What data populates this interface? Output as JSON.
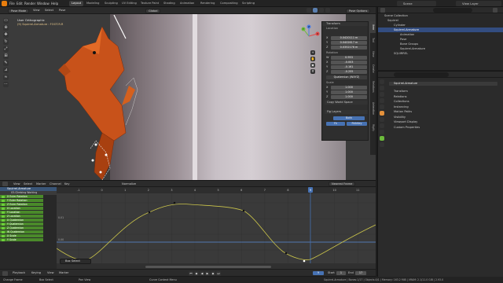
{
  "topbar": {
    "menus": [
      "File",
      "Edit",
      "Render",
      "Window",
      "Help"
    ],
    "workspaces": [
      "Layout",
      "Modeling",
      "Sculpting",
      "UV Editing",
      "Texture Paint",
      "Shading",
      "Animation",
      "Rendering",
      "Compositing",
      "Scripting"
    ],
    "active_workspace": "Layout",
    "scene": "Scene",
    "view_layer": "View Layer"
  },
  "viewport": {
    "mode": "Pose Mode",
    "menus": [
      "View",
      "Select",
      "Pose"
    ],
    "overlay_title": "User Orthographic",
    "overlay_subtitle": "(9) Squirrel-Armature : FOOT.R.R",
    "transform_orientation": "Global",
    "pose_options": "Pose Options",
    "axis_x": "X",
    "axis_y": "Y",
    "axis_z": "Z",
    "colors": {
      "background": "#3b3b3b",
      "wall_light": "#c8c0c6",
      "squirrel": "#c8521a"
    }
  },
  "npanel": {
    "title": "Transform",
    "location_label": "Location",
    "location": [
      {
        "axis": "X",
        "value": "0.0420111 m"
      },
      {
        "axis": "Y",
        "value": "0.0402617 m"
      },
      {
        "axis": "Z",
        "value": "0.0352176 m"
      }
    ],
    "rotation_label": "Rotation",
    "rotation": [
      {
        "axis": "W",
        "value": "0.953"
      },
      {
        "axis": "X",
        "value": "-0.003"
      },
      {
        "axis": "Y",
        "value": "-0.161"
      },
      {
        "axis": "Z",
        "value": "-0.255"
      }
    ],
    "rotation_mode": "Quaternion (WXYZ)",
    "scale_label": "Scale",
    "scale": [
      {
        "axis": "X",
        "value": "1.000"
      },
      {
        "axis": "Y",
        "value": "1.000"
      },
      {
        "axis": "Z",
        "value": "1.000"
      }
    ],
    "copy_world_space": "Copy World Space",
    "ik_fk_title": "Fig Layers",
    "buttons": [
      "Both",
      "Fk",
      "FkIkKey"
    ],
    "tabs": [
      "Item",
      "Tool",
      "View",
      "Create",
      "Relations",
      "Animation",
      "Rigify"
    ]
  },
  "outliner": {
    "title": "Scene Collection",
    "items": [
      {
        "label": "Squirrel",
        "indent": 1
      },
      {
        "label": "Cylinder",
        "indent": 2
      },
      {
        "label": "Squirrel-Armature",
        "indent": 2,
        "selected": true
      },
      {
        "label": "Animation",
        "indent": 3
      },
      {
        "label": "Pose",
        "indent": 3
      },
      {
        "label": "Bone Groups",
        "indent": 3
      },
      {
        "label": "Squirrel-Armature",
        "indent": 3
      },
      {
        "label": "SQUIRREL",
        "indent": 2
      }
    ]
  },
  "properties": {
    "object_name": "Squirrel-Armature",
    "sections": [
      "Transform",
      "Relations",
      "Collections",
      "Instancing",
      "Motion Paths",
      "Visibility",
      "Viewport Display",
      "Custom Properties"
    ]
  },
  "graph": {
    "menus": [
      "View",
      "Select",
      "Marker",
      "Channel",
      "Key"
    ],
    "normalize": "Normalize",
    "pivot": "Nearest Frame",
    "frame_ticks": [
      "-1",
      "0",
      "1",
      "2",
      "3",
      "4",
      "5",
      "6",
      "7",
      "8",
      "9",
      "10",
      "11",
      "12"
    ],
    "current_frame": "9",
    "channels_header": "Squirrel-Armature",
    "action": "03-Climbing Working",
    "channels": [
      "X Euler Rotation",
      "Y Euler Rotation",
      "Z Euler Rotation",
      "X Location",
      "Y Location",
      "Z Location",
      "X Quaternion",
      "Y Quaternion",
      "Z Quaternion",
      "W Quaternion",
      "X Scale",
      "Y Scale"
    ],
    "y_labels": [
      "0.00",
      "0.01",
      "0.02",
      "-0.01"
    ],
    "last_operator": "Box Select",
    "curve_color": "#c9c34a"
  },
  "timeline": {
    "menus": [
      "Playback",
      "Keying",
      "View",
      "Marker"
    ],
    "frame": "9",
    "start_label": "Start",
    "start": "1",
    "end_label": "End",
    "end": "17"
  },
  "statusbar": {
    "left": "Change Frame",
    "mid1": "Box Select",
    "mid2": "Pan View",
    "context": "Curve Context Menu",
    "stats": "Squirrel-Armature | Bones:1/17 | Objects:0/1 | Memory: 163.2 MiB | VRAM: 2.1/11.0 GiB | 2.93.0"
  }
}
